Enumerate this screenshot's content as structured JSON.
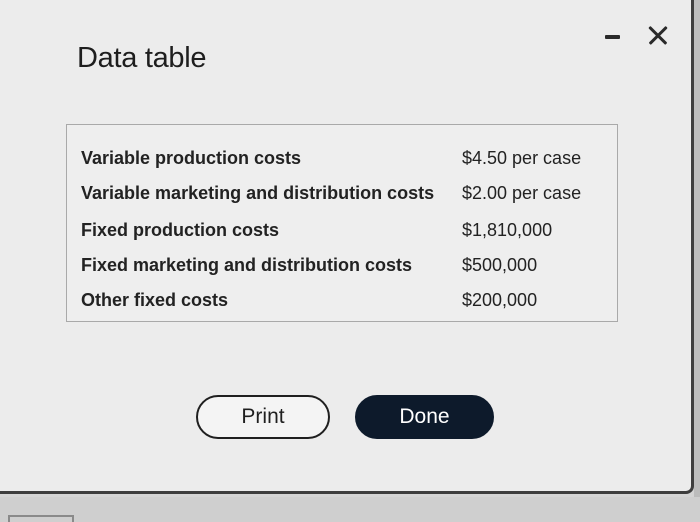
{
  "dialog": {
    "title": "Data table",
    "window_controls": {
      "minimize_icon": "minimize-icon",
      "close_icon": "close-icon"
    }
  },
  "table": {
    "rows": [
      {
        "label": "Variable production costs",
        "value": "$4.50 per case"
      },
      {
        "label": "Variable marketing and distribution costs",
        "value": "$2.00 per case"
      },
      {
        "label": "Fixed production costs",
        "value": "$1,810,000"
      },
      {
        "label": "Fixed marketing and distribution costs",
        "value": "$500,000"
      },
      {
        "label": "Other fixed costs",
        "value": "$200,000"
      }
    ]
  },
  "buttons": {
    "print_label": "Print",
    "done_label": "Done"
  },
  "colors": {
    "done_button_bg": "#0d1a2b",
    "dialog_bg": "#ececec",
    "text": "#222222"
  }
}
